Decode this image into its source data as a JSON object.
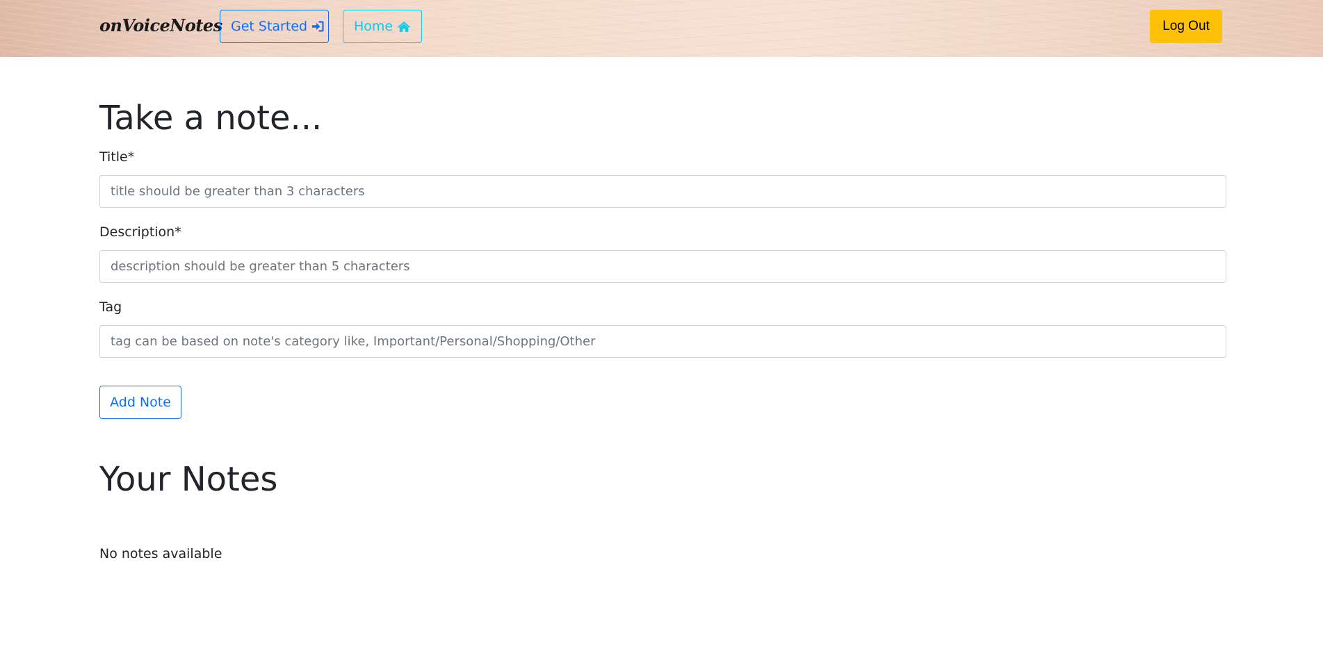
{
  "navbar": {
    "brand": "onVoiceNotes",
    "get_started_label": "Get Started",
    "home_label": "Home",
    "logout_label": "Log Out",
    "colors": {
      "get_started": "#0d6efd",
      "home": "#0dcaf0",
      "logout_bg": "#ffc107"
    }
  },
  "form": {
    "heading": "Take a note...",
    "title": {
      "label": "Title*",
      "placeholder": "title should be greater than 3 characters"
    },
    "description": {
      "label": "Description*",
      "placeholder": "description should be greater than 5 characters"
    },
    "tag": {
      "label": "Tag",
      "placeholder": "tag can be based on note's category like, Important/Personal/Shopping/Other"
    },
    "submit_label": "Add Note"
  },
  "notes": {
    "heading": "Your Notes",
    "empty_message": "No notes available"
  },
  "icons": {
    "get_started": "sign-in-icon",
    "home": "home-icon"
  }
}
